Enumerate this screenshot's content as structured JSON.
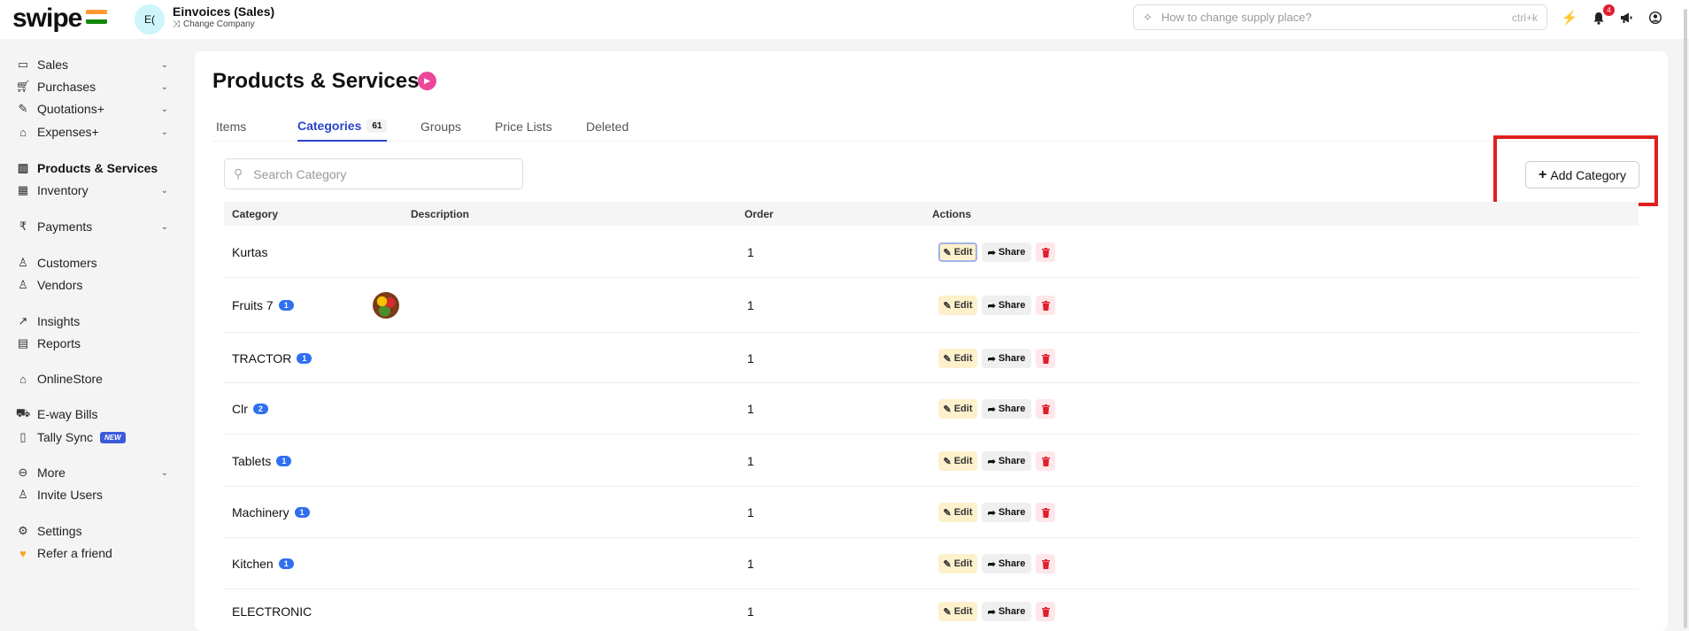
{
  "header": {
    "logo": "swipe",
    "company_avatar": "E(",
    "company_name": "Einvoices (Sales)",
    "change_company": "Change Company",
    "search_placeholder": "How to change supply place?",
    "search_shortcut": "ctrl+k",
    "notification_count": "4",
    "flag_colors": [
      "#ff9933",
      "#ffffff",
      "#138808"
    ]
  },
  "sidebar": {
    "items": [
      {
        "label": "Sales",
        "icon": "cash-icon",
        "chevron": true
      },
      {
        "label": "Purchases",
        "icon": "cart-icon",
        "chevron": true
      },
      {
        "label": "Quotations+",
        "icon": "pencil-icon",
        "chevron": true
      },
      {
        "label": "Expenses+",
        "icon": "tag-icon",
        "chevron": true
      },
      {
        "label": "Products & Services",
        "icon": "barcode-icon",
        "chevron": false,
        "active": true
      },
      {
        "label": "Inventory",
        "icon": "warehouse-icon",
        "chevron": true
      },
      {
        "label": "Payments",
        "icon": "rupee-icon",
        "chevron": true
      },
      {
        "label": "Customers",
        "icon": "user-icon",
        "chevron": false
      },
      {
        "label": "Vendors",
        "icon": "users-icon",
        "chevron": false
      },
      {
        "label": "Insights",
        "icon": "chart-icon",
        "chevron": false
      },
      {
        "label": "Reports",
        "icon": "report-icon",
        "chevron": false
      },
      {
        "label": "OnlineStore",
        "icon": "store-icon",
        "chevron": false
      },
      {
        "label": "E-way Bills",
        "icon": "truck-icon",
        "chevron": false
      },
      {
        "label": "Tally Sync",
        "icon": "file-icon",
        "chevron": false,
        "badge": "NEW"
      },
      {
        "label": "More",
        "icon": "more-icon",
        "chevron": true
      },
      {
        "label": "Invite Users",
        "icon": "user-plus-icon",
        "chevron": false
      },
      {
        "label": "Settings",
        "icon": "gear-icon",
        "chevron": false
      },
      {
        "label": "Refer a friend",
        "icon": "heart-hand-icon",
        "chevron": false
      }
    ]
  },
  "main": {
    "title": "Products & Services",
    "tabs": [
      {
        "label": "Items"
      },
      {
        "label": "Categories",
        "count": "61",
        "active": true
      },
      {
        "label": "Groups"
      },
      {
        "label": "Price Lists"
      },
      {
        "label": "Deleted"
      }
    ],
    "search_placeholder": "Search Category",
    "add_button": "Add Category",
    "columns": [
      "Category",
      "Description",
      "Order",
      "Actions"
    ],
    "actions": {
      "edit": "Edit",
      "share": "Share"
    },
    "rows": [
      {
        "category": "Kurtas",
        "count": "",
        "image": false,
        "order": "1"
      },
      {
        "category": "Fruits 7",
        "count": "1",
        "image": true,
        "order": "1"
      },
      {
        "category": "TRACTOR",
        "count": "1",
        "image": false,
        "order": "1"
      },
      {
        "category": "Clr",
        "count": "2",
        "image": false,
        "order": "1"
      },
      {
        "category": "Tablets",
        "count": "1",
        "image": false,
        "order": "1"
      },
      {
        "category": "Machinery",
        "count": "1",
        "image": false,
        "order": "1"
      },
      {
        "category": "Kitchen",
        "count": "1",
        "image": false,
        "order": "1"
      },
      {
        "category": "ELECTRONIC",
        "count": "",
        "image": false,
        "order": "1"
      }
    ]
  }
}
